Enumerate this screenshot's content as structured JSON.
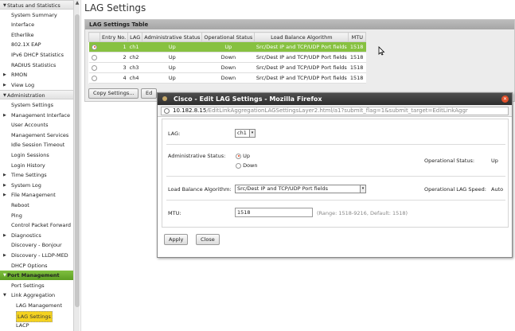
{
  "sidebar": {
    "items": [
      {
        "label": "Status and Statistics",
        "level": "hdr",
        "tri": "▼"
      },
      {
        "label": "System Summary",
        "level": "l1"
      },
      {
        "label": "Interface",
        "level": "l1"
      },
      {
        "label": "Etherlike",
        "level": "l1"
      },
      {
        "label": "802.1X EAP",
        "level": "l1"
      },
      {
        "label": "IPv6 DHCP Statistics",
        "level": "l1"
      },
      {
        "label": "RADIUS Statistics",
        "level": "l1"
      },
      {
        "label": "RMON",
        "level": "l1",
        "tri": "▶"
      },
      {
        "label": "View Log",
        "level": "l1",
        "tri": "▶"
      },
      {
        "label": "Administration",
        "level": "hdr",
        "tri": "▼"
      },
      {
        "label": "System Settings",
        "level": "l1"
      },
      {
        "label": "Management Interface",
        "level": "l1",
        "tri": "▶"
      },
      {
        "label": "User Accounts",
        "level": "l1"
      },
      {
        "label": "Management Services",
        "level": "l1"
      },
      {
        "label": "Idle Session Timeout",
        "level": "l1"
      },
      {
        "label": "Login Sessions",
        "level": "l1"
      },
      {
        "label": "Login History",
        "level": "l1"
      },
      {
        "label": "Time Settings",
        "level": "l1",
        "tri": "▶"
      },
      {
        "label": "System Log",
        "level": "l1",
        "tri": "▶"
      },
      {
        "label": "File Management",
        "level": "l1",
        "tri": "▶"
      },
      {
        "label": "Reboot",
        "level": "l1"
      },
      {
        "label": "Ping",
        "level": "l1"
      },
      {
        "label": "Control Packet Forward",
        "level": "l1"
      },
      {
        "label": "Diagnostics",
        "level": "l1",
        "tri": "▶"
      },
      {
        "label": "Discovery - Bonjour",
        "level": "l1"
      },
      {
        "label": "Discovery - LLDP-MED",
        "level": "l1",
        "tri": "▶"
      },
      {
        "label": "DHCP Options",
        "level": "l1"
      },
      {
        "label": "Port Management",
        "level": "hdr-green",
        "tri": "▼"
      },
      {
        "label": "Port Settings",
        "level": "l1"
      },
      {
        "label": "Link Aggregation",
        "level": "l1",
        "tri": "▼"
      },
      {
        "label": "LAG Management",
        "level": "l2"
      },
      {
        "label": "LAG Settings",
        "level": "l2",
        "selected": true
      },
      {
        "label": "LACP",
        "level": "l2"
      }
    ]
  },
  "page": {
    "title": "LAG Settings",
    "table_title": "LAG Settings Table",
    "columns": [
      "Entry No.",
      "LAG",
      "Administrative Status",
      "Operational Status",
      "Load Balance Algorithm",
      "MTU"
    ],
    "rows": [
      {
        "entry": "1",
        "lag": "ch1",
        "admin": "Up",
        "oper": "Up",
        "lb": "Src/Dest IP and TCP/UDP Port fields",
        "mtu": "1518",
        "selected": true
      },
      {
        "entry": "2",
        "lag": "ch2",
        "admin": "Up",
        "oper": "Down",
        "lb": "Src/Dest IP and TCP/UDP Port fields",
        "mtu": "1518"
      },
      {
        "entry": "3",
        "lag": "ch3",
        "admin": "Up",
        "oper": "Down",
        "lb": "Src/Dest IP and TCP/UDP Port fields",
        "mtu": "1518"
      },
      {
        "entry": "4",
        "lag": "ch4",
        "admin": "Up",
        "oper": "Down",
        "lb": "Src/Dest IP and TCP/UDP Port fields",
        "mtu": "1518"
      }
    ],
    "copy_settings_label": "Copy Settings...",
    "edit_label": "Ed"
  },
  "dialog": {
    "title": "Cisco - Edit LAG Settings - Mozilla Firefox",
    "url_host": "10.182.8.15",
    "url_path": "/EditLinkAggregationLAGSettingsLayer2.html/a1?submit_flag=1&submit_target=EditLinkAggr",
    "lag_label": "LAG:",
    "lag_value": "ch1",
    "admin_label": "Administrative Status:",
    "admin_up": "Up",
    "admin_down": "Down",
    "oper_label": "Operational Status:",
    "oper_value": "Up",
    "lb_label": "Load Balance Algorithm:",
    "lb_value": "Src/Dest IP and TCP/UDP Port fields",
    "oper_speed_label": "Operational LAG Speed:",
    "oper_speed_value": "Auto",
    "mtu_label": "MTU:",
    "mtu_value": "1518",
    "mtu_hint": "(Range: 1518-9216, Default: 1518)",
    "apply_label": "Apply",
    "close_label": "Close"
  }
}
